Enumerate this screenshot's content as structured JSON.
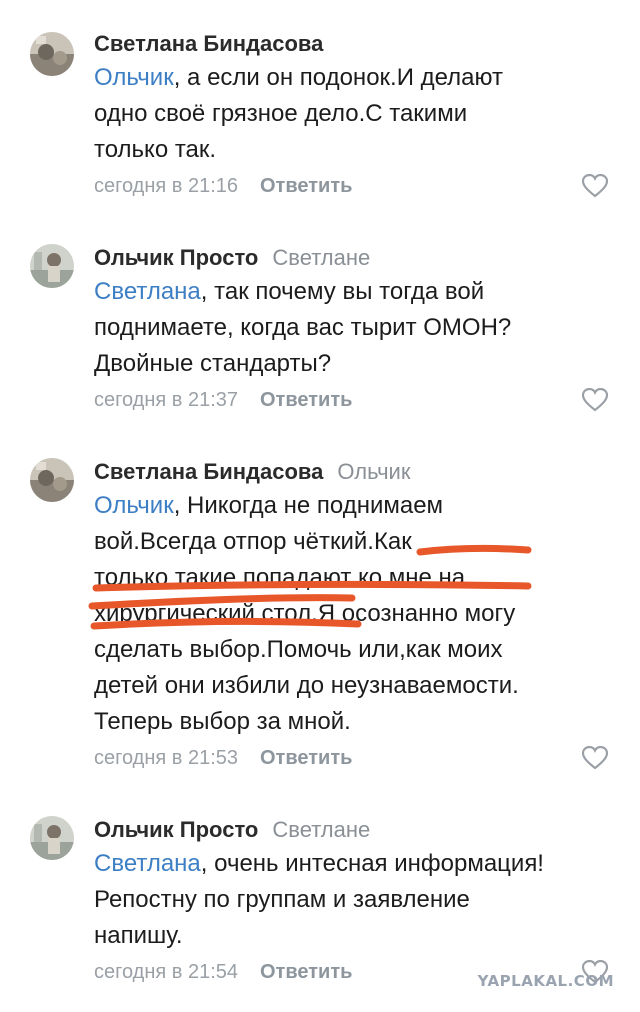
{
  "comments": [
    {
      "author": "Светлана Биндасова",
      "reply_to": "",
      "mention": "Ольчик",
      "lines": [
        ", а если он подонок.И делают",
        "одно своё грязное дело.С такими",
        "только так."
      ],
      "time": "сегодня в 21:16",
      "reply_label": "Ответить"
    },
    {
      "author": "Ольчик Просто",
      "reply_to": "Светлане",
      "mention": "Светлана",
      "lines": [
        ", так почему вы тогда вой",
        "поднимаете, когда вас тырит ОМОН?",
        "Двойные стандарты?"
      ],
      "time": "сегодня в 21:37",
      "reply_label": "Ответить"
    },
    {
      "author": "Светлана Биндасова",
      "reply_to": "Ольчик",
      "mention": "Ольчик",
      "lines": [
        ", Никогда не поднимаем",
        "вой.Всегда отпор чёткий.Как",
        "только такие попадают ко мне на",
        "хирургический стол.Я осознанно могу",
        "сделать выбор.Помочь или,как моих",
        "детей они избили до неузнаваемости.",
        "Теперь выбор за мной."
      ],
      "time": "сегодня в 21:53",
      "reply_label": "Ответить"
    },
    {
      "author": "Ольчик Просто",
      "reply_to": "Светлане",
      "mention": "Светлана",
      "lines": [
        ", очень интесная информация!",
        "Репостну по группам и заявление",
        "напишу."
      ],
      "time": "сегодня в 21:54",
      "reply_label": "Ответить"
    }
  ],
  "icons": {
    "like": "heart-icon"
  },
  "colors": {
    "mention": "#3d7fc4",
    "meta": "#9aa0a6",
    "marker": "#e8572a"
  },
  "watermark": "YAPLAKAL.COM"
}
